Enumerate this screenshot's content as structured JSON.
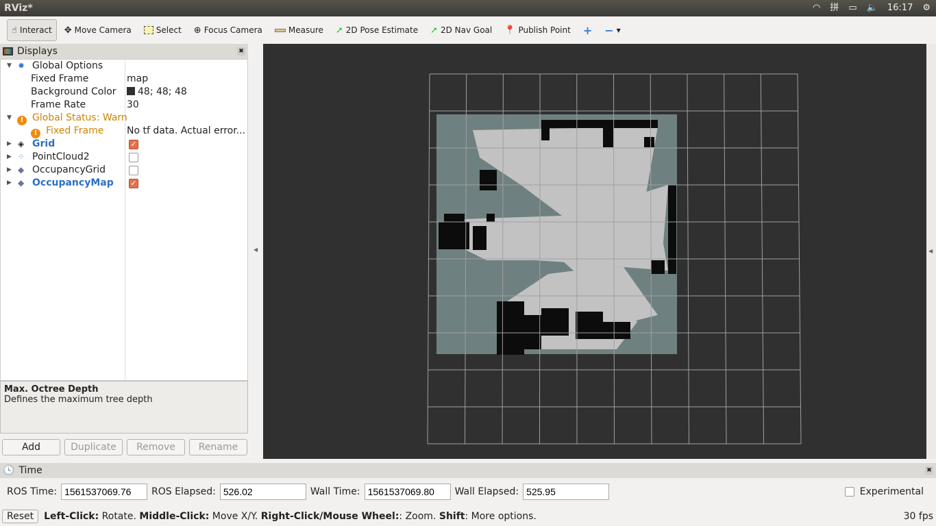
{
  "window": {
    "title": "RViz*",
    "clock": "16:17"
  },
  "toolbar": {
    "tools": [
      {
        "label": "Interact",
        "icon": "hand-icon",
        "active": true
      },
      {
        "label": "Move Camera",
        "icon": "move-camera-icon"
      },
      {
        "label": "Select",
        "icon": "select-icon"
      },
      {
        "label": "Focus Camera",
        "icon": "focus-camera-icon"
      },
      {
        "label": "Measure",
        "icon": "ruler-icon"
      },
      {
        "label": "2D Pose Estimate",
        "icon": "green-arrow-icon"
      },
      {
        "label": "2D Nav Goal",
        "icon": "green-arrow-icon"
      },
      {
        "label": "Publish Point",
        "icon": "map-pin-icon"
      }
    ]
  },
  "displays": {
    "title": "Displays",
    "global_options": "Global Options",
    "fixed_frame": {
      "label": "Fixed Frame",
      "value": "map"
    },
    "background_color": {
      "label": "Background Color",
      "value": "48; 48; 48"
    },
    "frame_rate": {
      "label": "Frame Rate",
      "value": "30"
    },
    "global_status": "Global Status: Warn",
    "status_fixed_frame": {
      "label": "Fixed Frame",
      "value": "No tf data.  Actual error..."
    },
    "items": [
      {
        "label": "Grid",
        "checked": true
      },
      {
        "label": "PointCloud2",
        "checked": false
      },
      {
        "label": "OccupancyGrid",
        "checked": false
      },
      {
        "label": "OccupancyMap",
        "checked": true
      }
    ],
    "description": {
      "title": "Max. Octree Depth",
      "text": "Defines the maximum tree depth"
    },
    "buttons": {
      "add": "Add",
      "duplicate": "Duplicate",
      "remove": "Remove",
      "rename": "Rename"
    }
  },
  "time": {
    "title": "Time",
    "ros_time_label": "ROS Time:",
    "ros_time": "1561537069.76",
    "ros_elapsed_label": "ROS Elapsed:",
    "ros_elapsed": "526.02",
    "wall_time_label": "Wall Time:",
    "wall_time": "1561537069.80",
    "wall_elapsed_label": "Wall Elapsed:",
    "wall_elapsed": "525.95",
    "experimental": "Experimental"
  },
  "status": {
    "reset": "Reset",
    "k1": "Left-Click:",
    "t1": " Rotate. ",
    "k2": "Middle-Click:",
    "t2": " Move X/Y. ",
    "k3": "Right-Click/Mouse Wheel:",
    "t3": ": Zoom. ",
    "k4": "Shift",
    "t4": ": More options.",
    "fps": "30 fps"
  },
  "colors": {
    "background": "#303030",
    "map_unknown": "#6f8080",
    "map_free": "#c2c2c2",
    "map_occupied": "#0c0c0c"
  }
}
